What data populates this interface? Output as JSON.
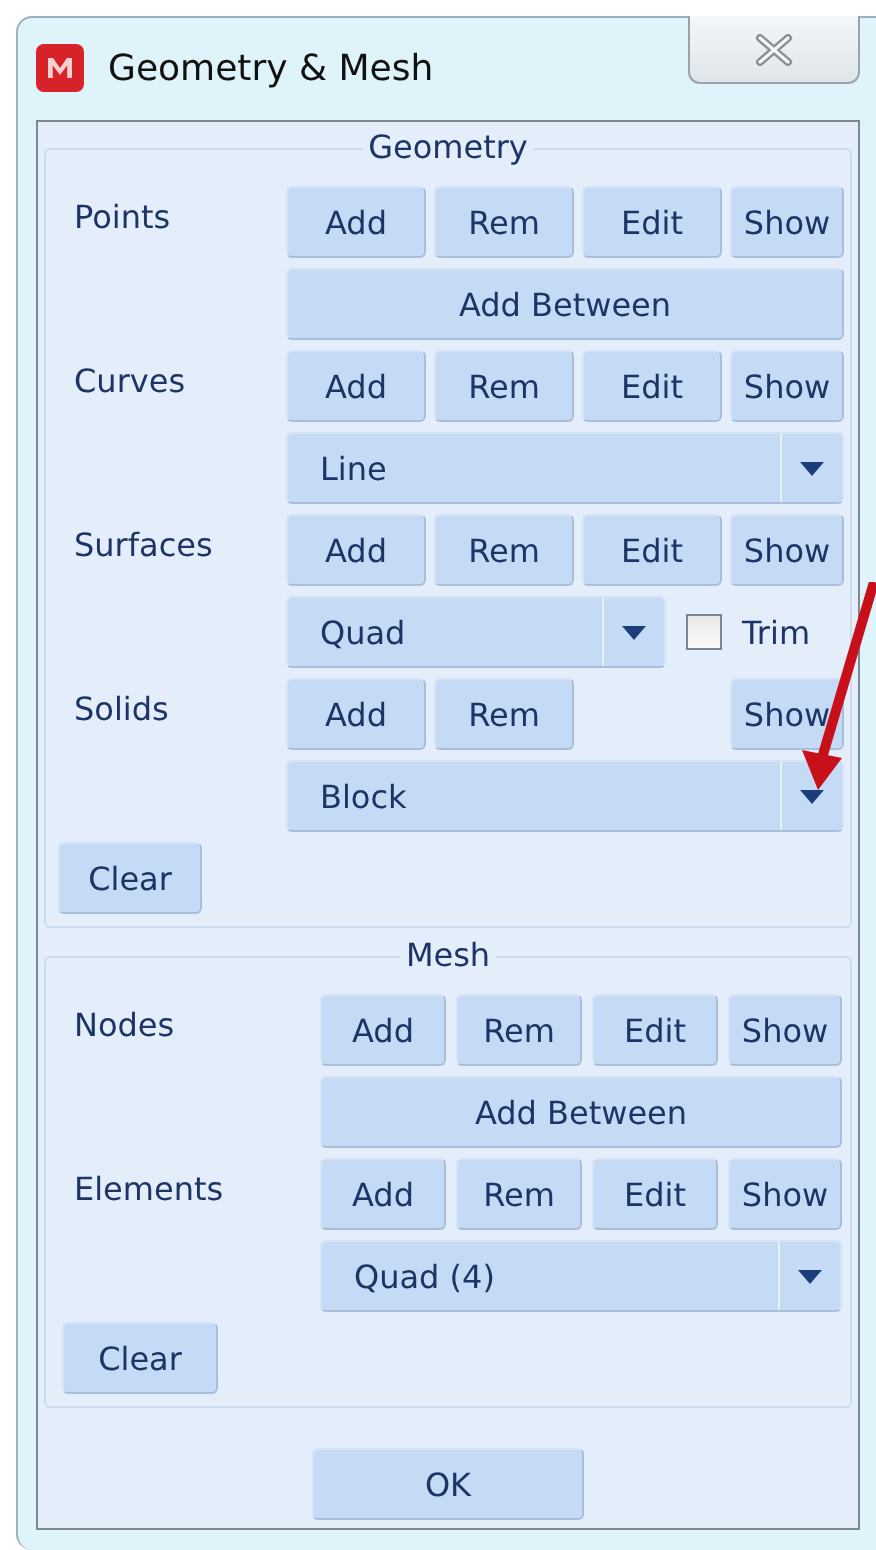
{
  "window": {
    "title": "Geometry & Mesh"
  },
  "sections": [
    {
      "title": "Geometry",
      "rows": [
        {
          "kind": "buttons",
          "label": "Points",
          "buttons": [
            {
              "kind": "button",
              "label": "Add"
            },
            {
              "kind": "button",
              "label": "Rem"
            },
            {
              "kind": "button",
              "label": "Edit"
            },
            {
              "kind": "button",
              "label": "Show"
            }
          ]
        },
        {
          "kind": "wide",
          "text": "Add Between"
        },
        {
          "kind": "buttons",
          "label": "Curves",
          "buttons": [
            {
              "kind": "button",
              "label": "Add"
            },
            {
              "kind": "button",
              "label": "Rem"
            },
            {
              "kind": "button",
              "label": "Edit"
            },
            {
              "kind": "button",
              "label": "Show"
            }
          ]
        },
        {
          "kind": "dropdown",
          "value": "Line"
        },
        {
          "kind": "buttons",
          "label": "Surfaces",
          "buttons": [
            {
              "kind": "button",
              "label": "Add"
            },
            {
              "kind": "button",
              "label": "Rem"
            },
            {
              "kind": "button",
              "label": "Edit"
            },
            {
              "kind": "button",
              "label": "Show"
            }
          ]
        },
        {
          "kind": "dropdown_check",
          "value": "Quad",
          "check_label": "Trim",
          "checked": false
        },
        {
          "kind": "buttons",
          "label": "Solids",
          "buttons": [
            {
              "kind": "button",
              "label": "Add"
            },
            {
              "kind": "button",
              "label": "Rem"
            },
            {
              "kind": "gap"
            },
            {
              "kind": "button",
              "label": "Show"
            }
          ]
        },
        {
          "kind": "dropdown",
          "value": "Block"
        }
      ],
      "clear": "Clear"
    },
    {
      "title": "Mesh",
      "rows": [
        {
          "kind": "buttons",
          "label": "Nodes",
          "buttons": [
            {
              "kind": "button",
              "label": "Add"
            },
            {
              "kind": "button",
              "label": "Rem"
            },
            {
              "kind": "button",
              "label": "Edit"
            },
            {
              "kind": "button",
              "label": "Show"
            }
          ]
        },
        {
          "kind": "wide",
          "text": "Add Between"
        },
        {
          "kind": "buttons",
          "label": "Elements",
          "buttons": [
            {
              "kind": "button",
              "label": "Add"
            },
            {
              "kind": "button",
              "label": "Rem"
            },
            {
              "kind": "button",
              "label": "Edit"
            },
            {
              "kind": "button",
              "label": "Show"
            }
          ]
        },
        {
          "kind": "dropdown",
          "value": "Quad (4)"
        }
      ],
      "clear": "Clear"
    }
  ],
  "ok": "OK"
}
